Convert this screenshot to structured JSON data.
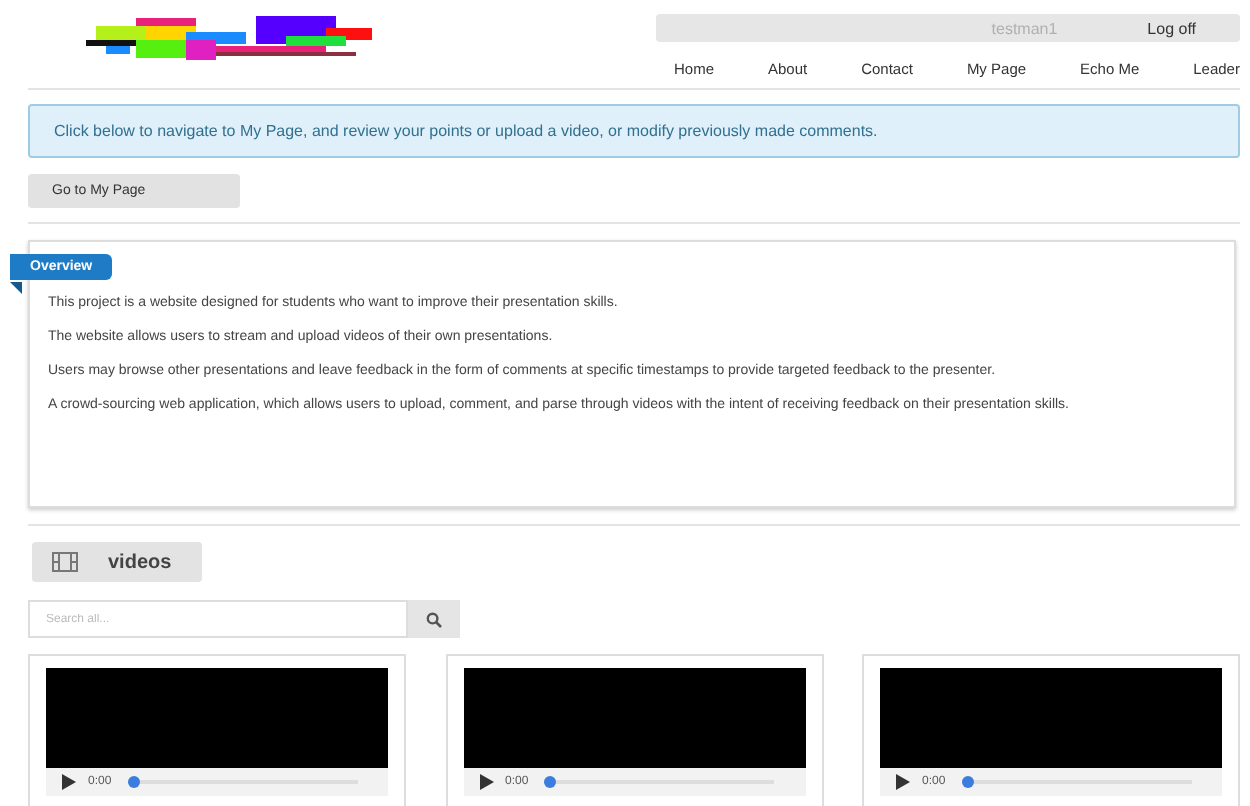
{
  "user_bar": {
    "username": "testman1",
    "logoff": "Log off"
  },
  "nav": [
    "Home",
    "About",
    "Contact",
    "My Page",
    "Echo Me",
    "Leader"
  ],
  "alert": "Click below to navigate to My Page, and review your points or upload a video, or modify previously made comments.",
  "go_button": "Go to My Page",
  "overview": {
    "ribbon": "Overview",
    "paragraphs": [
      "This project is a website designed for students who want to improve their presentation skills.",
      "The website allows users to stream and upload videos of their own presentations.",
      "Users may browse other presentations and leave feedback in the form of comments at specific timestamps to provide targeted feedback to the presenter.",
      "A crowd-sourcing web application, which allows users to upload, comment, and parse through videos with the intent of receiving feedback on their presentation skills."
    ]
  },
  "videos": {
    "heading": "videos",
    "search": {
      "placeholder": "Search all..."
    },
    "items": [
      {
        "time": "0:00",
        "level": 0
      },
      {
        "time": "0:00",
        "level": 0
      },
      {
        "time": "0:00",
        "level": 0
      }
    ]
  }
}
